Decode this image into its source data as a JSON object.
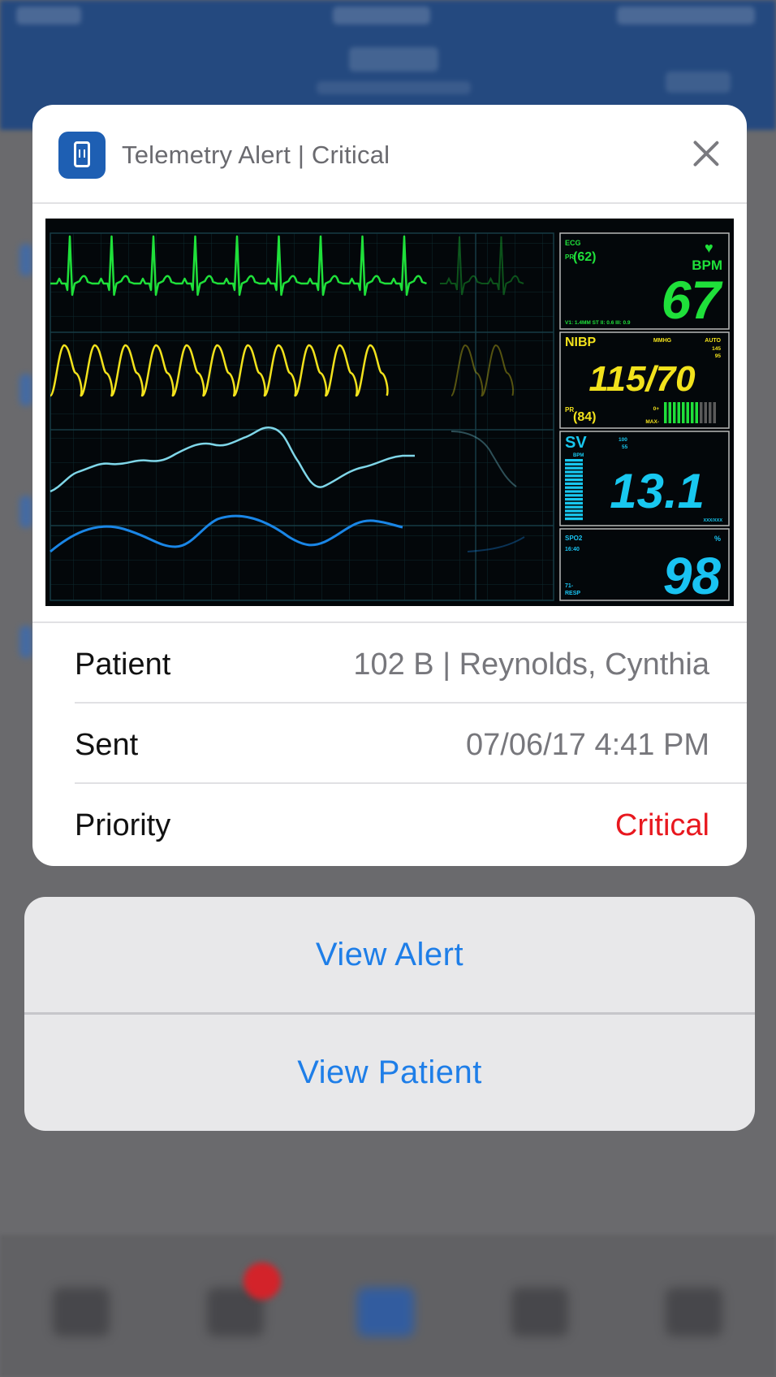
{
  "notification": {
    "app_icon": "hospital-phone-icon",
    "title": "Telemetry Alert | Critical",
    "close_icon": "close-icon"
  },
  "monitor": {
    "ecg": {
      "label": "ECG",
      "pr_label": "PR",
      "pr_value": "(62)",
      "unit": "BPM",
      "value": "67",
      "footer": "V1: 1.4MM  ST II: 0.6  III: 0.9"
    },
    "nibp": {
      "label": "NIBP",
      "unit": "MMHG",
      "mode": "AUTO",
      "side_top": "145",
      "side_bottom": "95",
      "value": "115/70",
      "pr_label": "PR",
      "pr_value": "(84)",
      "bar_label_left": "0+",
      "bar_label_max": "MAX-"
    },
    "sv": {
      "label": "SV",
      "side_top": "100",
      "side_bottom": "55",
      "sub": "BPM",
      "value": "13.1",
      "footer": "XXX/XXX"
    },
    "spo2": {
      "label": "SPO2",
      "time": "16:40",
      "unit": "%",
      "resp_label": "RESP",
      "resp_value": "71-",
      "value": "98"
    },
    "colors": {
      "ecg": "#1fe03a",
      "nibp": "#f2e21c",
      "sv": "#18c8f0",
      "spo2": "#19c3f2",
      "wave4": "#1a86e6",
      "wave3": "#7fd6e8"
    }
  },
  "details": [
    {
      "label": "Patient",
      "value": "102 B | Reynolds, Cynthia"
    },
    {
      "label": "Sent",
      "value": "07/06/17 4:41 PM"
    },
    {
      "label": "Priority",
      "value": "Critical",
      "value_color": "#e8181f"
    }
  ],
  "actions": {
    "view_alert": "View Alert",
    "view_patient": "View Patient"
  }
}
